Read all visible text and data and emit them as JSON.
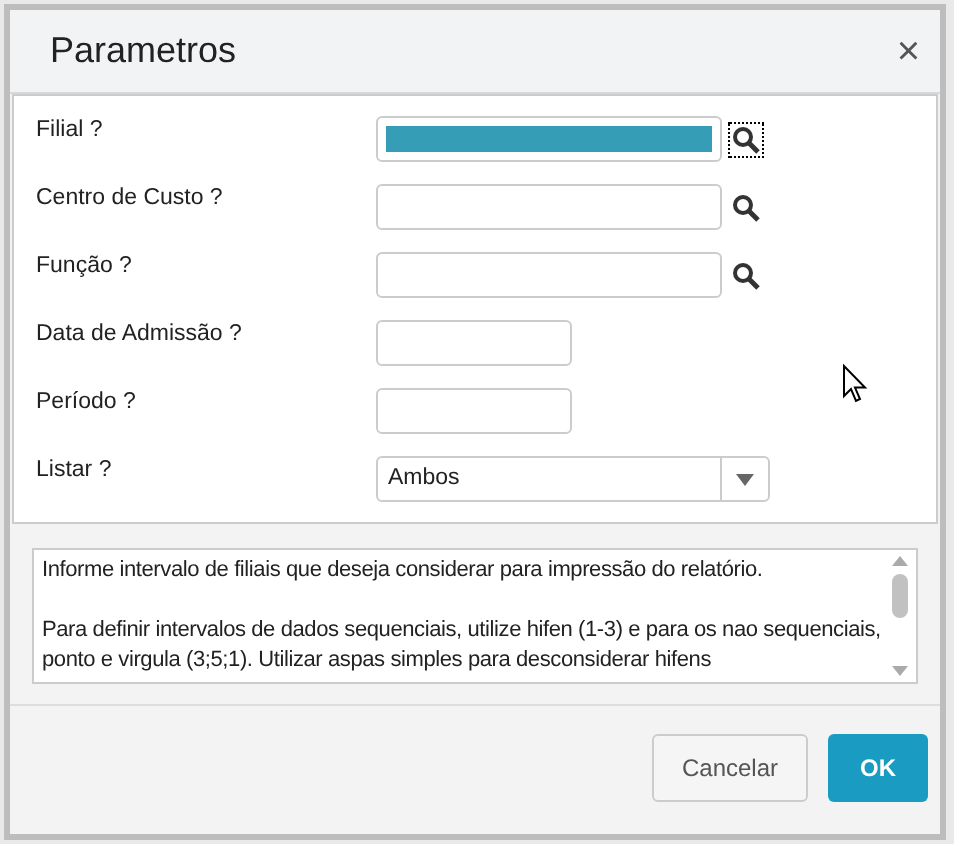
{
  "window": {
    "title": "Parametros",
    "close": "×"
  },
  "fields": [
    {
      "label": "Filial ?",
      "kind": "lookup",
      "highlighted": true,
      "focused": true
    },
    {
      "label": "Centro de Custo ?",
      "kind": "lookup",
      "highlighted": false,
      "focused": false
    },
    {
      "label": "Função ?",
      "kind": "lookup",
      "highlighted": false,
      "focused": false
    },
    {
      "label": "Data de Admissão ?",
      "kind": "short"
    },
    {
      "label": "Período ?",
      "kind": "short"
    },
    {
      "label": "Listar ?",
      "kind": "select",
      "value": "Ambos"
    }
  ],
  "help": [
    "Informe intervalo de filiais que deseja considerar para impressão do relatório.",
    "Para definir intervalos de dados sequenciais, utilize hifen (1-3) e para os nao sequenciais, ponto e virgula (3;5;1). Utilizar aspas simples para desconsiderar hifens"
  ],
  "buttons": [
    {
      "label": "Cancelar",
      "kind": "secondary"
    },
    {
      "label": "OK",
      "kind": "primary"
    }
  ]
}
